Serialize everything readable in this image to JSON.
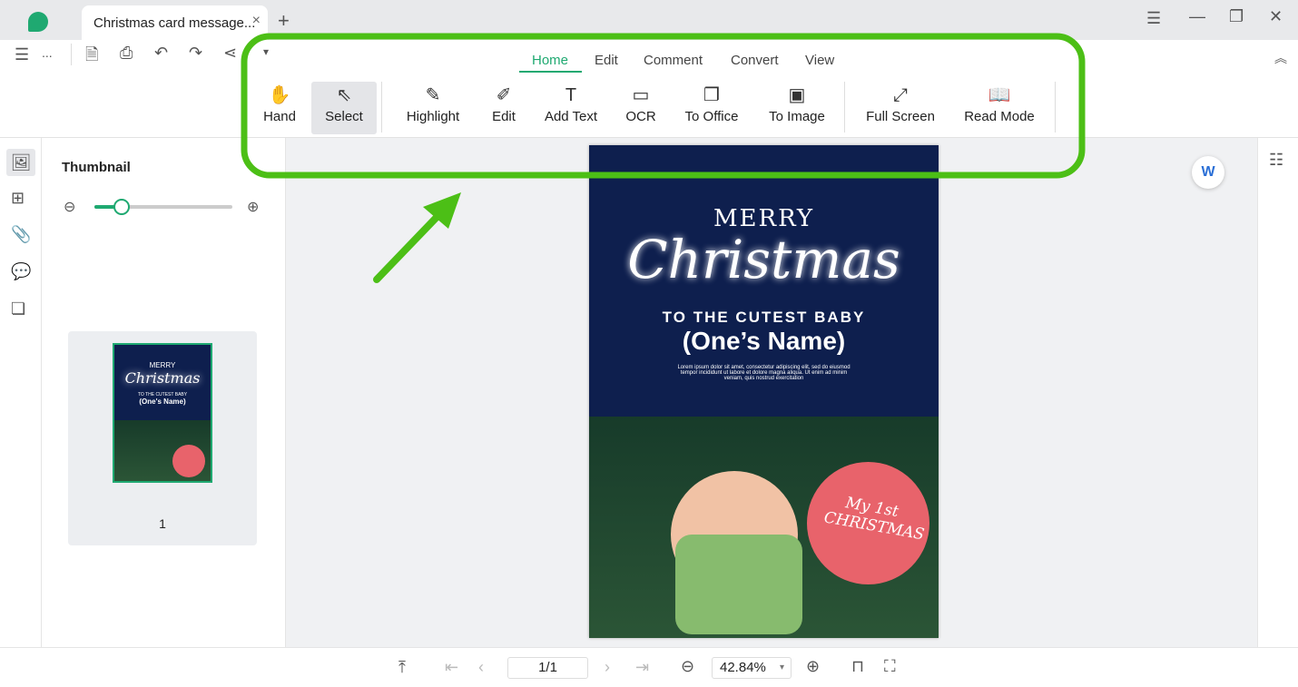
{
  "tab": {
    "title": "Christmas card message...",
    "close": "×",
    "new": "+"
  },
  "quick": {
    "menu": "☰",
    "more": "..."
  },
  "menu_tabs": [
    "Home",
    "Edit",
    "Comment",
    "Convert",
    "View"
  ],
  "active_menu_tab": "Home",
  "tools": [
    {
      "label": "Hand",
      "icon": "hand-icon",
      "glyph": "✋"
    },
    {
      "label": "Select",
      "icon": "cursor-icon",
      "glyph": "⇖"
    },
    {
      "label": "Highlight",
      "icon": "highlighter-icon",
      "glyph": "✎"
    },
    {
      "label": "Edit",
      "icon": "edit-document-icon",
      "glyph": "✐"
    },
    {
      "label": "Add Text",
      "icon": "add-text-icon",
      "glyph": "T"
    },
    {
      "label": "OCR",
      "icon": "ocr-icon",
      "glyph": "▭"
    },
    {
      "label": "To Office",
      "icon": "to-office-icon",
      "glyph": "❐"
    },
    {
      "label": "To Image",
      "icon": "to-image-icon",
      "glyph": "▣"
    },
    {
      "label": "Full Screen",
      "icon": "full-screen-icon",
      "glyph": "⤢"
    },
    {
      "label": "Read Mode",
      "icon": "book-icon",
      "glyph": "📖"
    }
  ],
  "selected_tool": "Select",
  "thumbnail": {
    "title": "Thumbnail",
    "zoom_fraction": 0.2,
    "page_label": "1"
  },
  "card": {
    "merry": "MERRY",
    "christmas": "Christmas",
    "to": "TO THE CUTEST BABY",
    "name": "(One’s Name)",
    "lorem": "Lorem ipsum dolor sit amet, consectetur adipiscing elit, sed do eiusmod tempor incididunt ut labore et dolore magna aliqua. Ut enim ad minim veniam, quis nostrud exercitation",
    "ornament": "My 1st CHRISTMAS"
  },
  "thumb_card": {
    "merry": "MERRY",
    "christmas": "Christmas",
    "to": "TO THE CUTEST BABY",
    "name": "(One's Name)"
  },
  "bottom": {
    "page": "1/1",
    "zoom": "42.84%"
  },
  "colors": {
    "accent": "#1fa971",
    "annotation": "#4cbf16",
    "card_bg": "#0e1f4e"
  }
}
